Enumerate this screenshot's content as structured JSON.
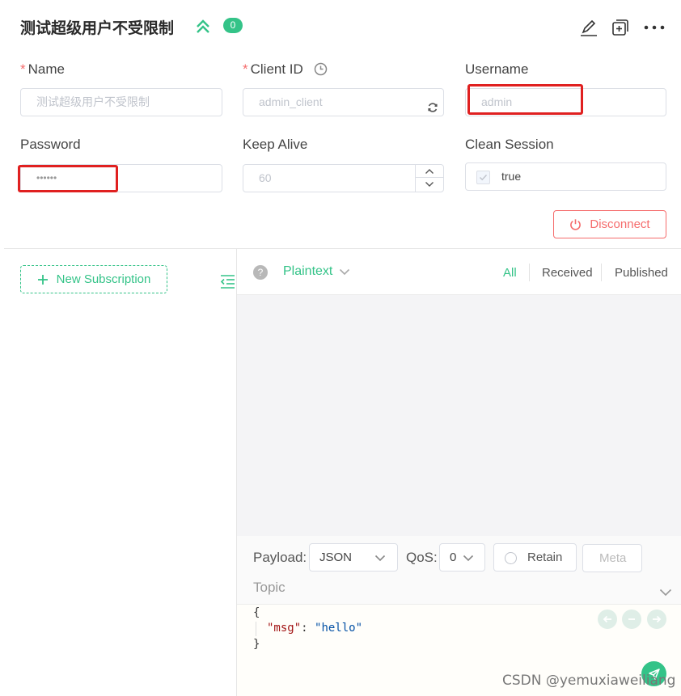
{
  "header": {
    "title": "测试超级用户不受限制",
    "badge_count": "0"
  },
  "form": {
    "name": {
      "label": "Name",
      "required_mark": "*",
      "placeholder": "测试超级用户不受限制"
    },
    "client_id": {
      "label": "Client ID",
      "required_mark": "*",
      "value": "admin_client"
    },
    "username": {
      "label": "Username",
      "value": "admin"
    },
    "password": {
      "label": "Password",
      "value": "••••••"
    },
    "keep_alive": {
      "label": "Keep Alive",
      "value": "60"
    },
    "clean_session": {
      "label": "Clean Session",
      "value": "true"
    },
    "disconnect_label": "Disconnect"
  },
  "subscriptions": {
    "new_label": "New Subscription"
  },
  "messages": {
    "format": "Plaintext",
    "tabs": [
      "All",
      "Received",
      "Published"
    ],
    "active_tab": "All"
  },
  "composer": {
    "payload_label": "Payload:",
    "payload_type": "JSON",
    "qos_label": "QoS:",
    "qos_value": "0",
    "retain_label": "Retain",
    "meta_label": "Meta",
    "topic_placeholder": "Topic",
    "payload_lines": [
      "{",
      "  \"msg\": \"hello\"",
      "}"
    ],
    "payload_key": "\"msg\"",
    "payload_sep": ": ",
    "payload_val": "\"hello\""
  },
  "watermark": "CSDN @yemuxiaweiliang",
  "colors": {
    "accent": "#34c388",
    "danger": "#f56c6c",
    "highlight_box": "#e02020"
  }
}
